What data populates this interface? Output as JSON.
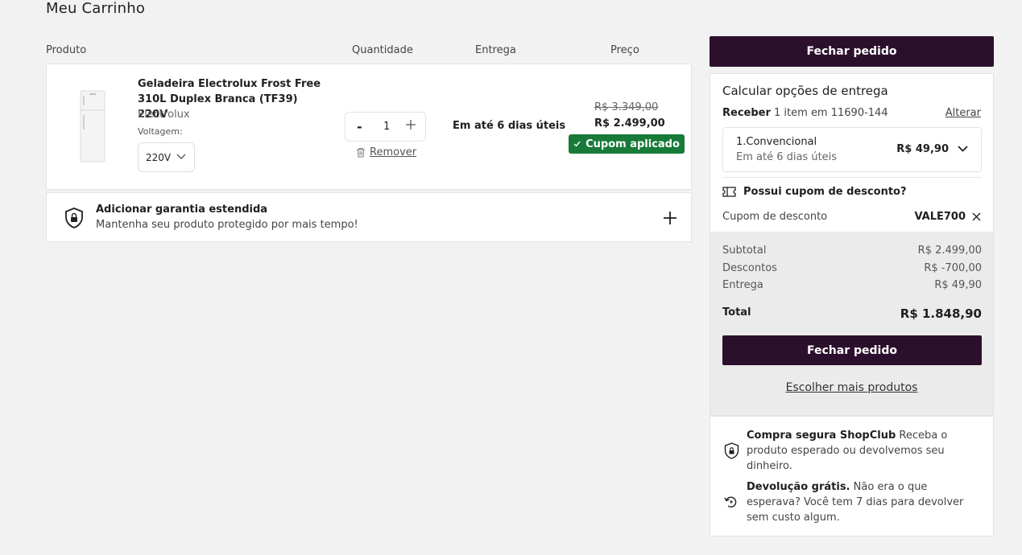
{
  "page": {
    "title": "Meu Carrinho"
  },
  "columns": {
    "produto": "Produto",
    "quantidade": "Quantidade",
    "entrega": "Entrega",
    "preco": "Preço"
  },
  "product": {
    "name": "Geladeira Electrolux Frost Free 310L Duplex Branca (TF39) 220V",
    "brand": "Electrolux",
    "voltage_label": "Voltagem:",
    "voltage_value": "220V",
    "quantity": "1",
    "qty_minus": "-",
    "remove_label": "Remover",
    "delivery": "Em até 6 dias úteis",
    "old_price": "R$ 3.349,00",
    "new_price": "R$ 2.499,00",
    "coupon_badge": "Cupom aplicado"
  },
  "warranty": {
    "title": "Adicionar garantia estendida",
    "subtitle": "Mantenha seu produto protegido por mais tempo!"
  },
  "checkout_label": "Fechar pedido",
  "summary": {
    "title": "Calcular opções de entrega",
    "receber_label": "Receber",
    "receber_detail": "1 item em 11690-144",
    "alterar_label": "Alterar",
    "shipping": {
      "name": "1.Convencional",
      "time": "Em até 6 dias úteis",
      "price": "R$ 49,90"
    },
    "coupon_question": "Possui cupom de desconto?",
    "coupon_label": "Cupom de desconto",
    "coupon_code": "VALE700",
    "subtotal_label": "Subtotal",
    "subtotal_value": "R$ 2.499,00",
    "descontos_label": "Descontos",
    "descontos_value": "R$ -700,00",
    "entrega_label": "Entrega",
    "entrega_value": "R$ 49,90",
    "total_label": "Total",
    "total_value": "R$ 1.848,90",
    "more_products": "Escolher mais produtos"
  },
  "secure": {
    "item1_title": "Compra segura ShopClub",
    "item1_text": "Receba o produto esperado ou devolvemos seu dinheiro.",
    "item2_title": "Devolução grátis.",
    "item2_text": "Não era o que esperava? Você tem 7 dias para devolver sem custo algum."
  },
  "colors": {
    "dark_button": "#2c0f2d",
    "coupon_green": "#177a38",
    "background": "#f2f2f2"
  }
}
